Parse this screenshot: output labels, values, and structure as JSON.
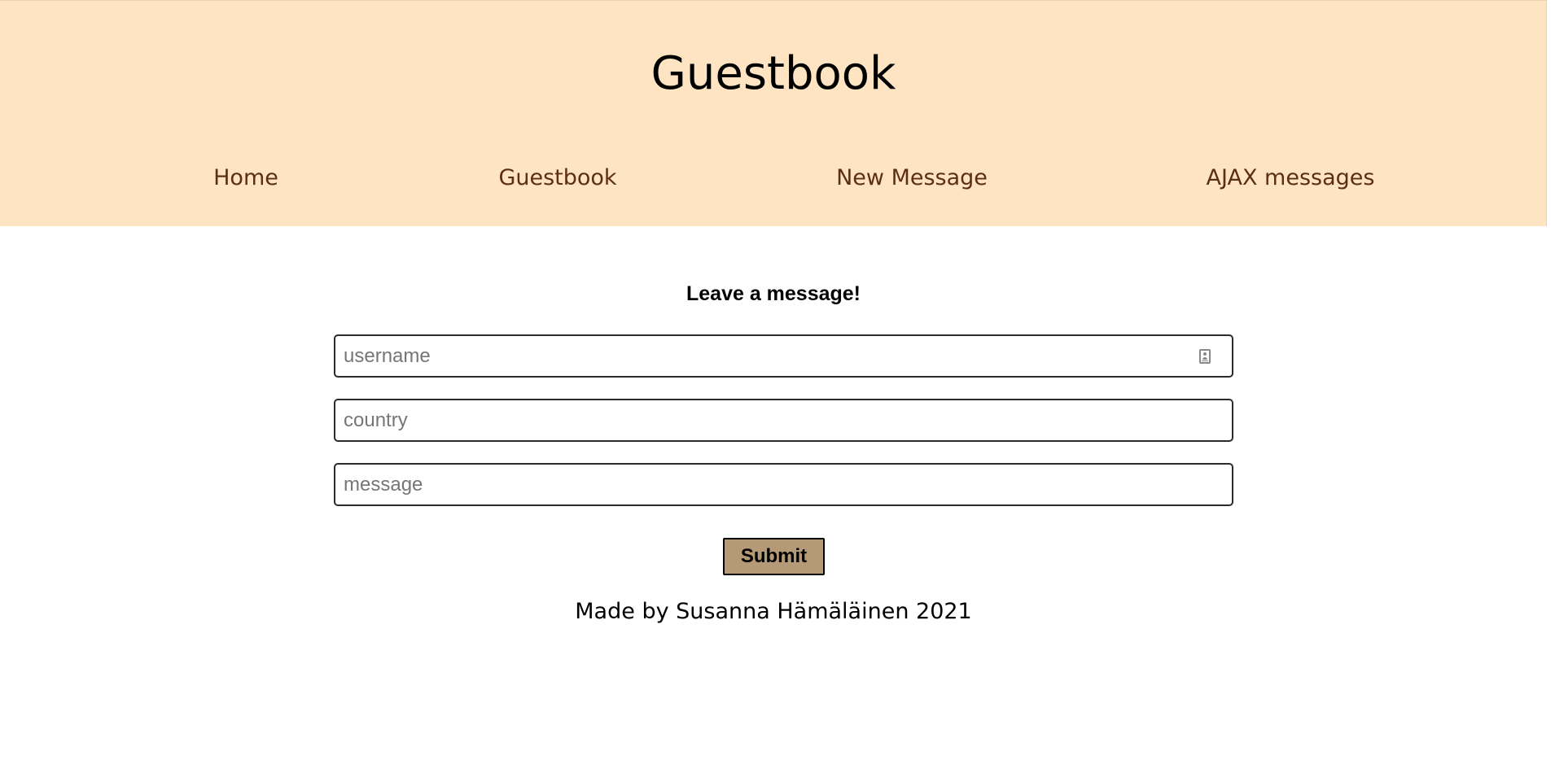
{
  "header": {
    "title": "Guestbook",
    "background_color": "#ffe4c4",
    "nav": [
      {
        "label": "Home"
      },
      {
        "label": "Guestbook"
      },
      {
        "label": "New Message"
      },
      {
        "label": "AJAX messages"
      }
    ],
    "nav_color": "#5c2e14"
  },
  "form": {
    "heading": "Leave a message!",
    "username": {
      "placeholder": "username",
      "value": "",
      "icon": "contact-card-icon"
    },
    "country": {
      "placeholder": "country",
      "value": ""
    },
    "message": {
      "placeholder": "message",
      "value": ""
    },
    "submit_label": "Submit",
    "submit_color": "#b49a76"
  },
  "footer": {
    "text": "Made by Susanna Hämäläinen 2021"
  }
}
